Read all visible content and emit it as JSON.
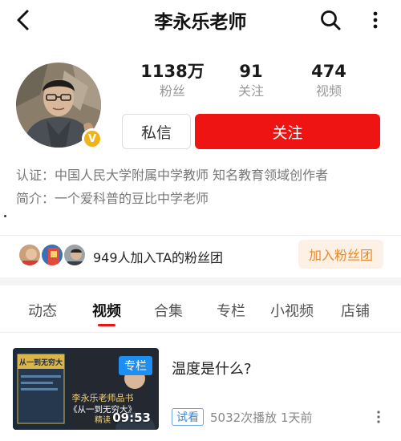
{
  "header": {
    "title": "李永乐老师"
  },
  "profile": {
    "badge_letter": "V",
    "stats": [
      {
        "value": "1138万",
        "label": "粉丝"
      },
      {
        "value": "91",
        "label": "关注"
      },
      {
        "value": "474",
        "label": "视频"
      }
    ],
    "message_label": "私信",
    "follow_label": "关注",
    "certification": "认证：中国人民大学附属中学教师 知名教育领域创作者",
    "intro": "简介：一个爱科普的豆比中学老师"
  },
  "fan_club": {
    "text": "949人加入TA的粉丝团",
    "join_label": "加入粉丝团"
  },
  "tabs": [
    "动态",
    "视频",
    "合集",
    "专栏",
    "小视频",
    "店铺"
  ],
  "active_tab": "视频",
  "video": {
    "thumb_badge": "专栏",
    "duration": "09:53",
    "thumb_book_title": "从一到无穷大",
    "thumb_line1": "李永乐老师品书",
    "thumb_line2": "《从一到无穷大》",
    "thumb_line3": "精读",
    "title": "温度是什么?",
    "trial_label": "试看",
    "meta": "5032次播放  1天前"
  },
  "colors": {
    "accent_red": "#ef1414",
    "fan_button_bg": "#fdf1e6",
    "fan_button_text": "#e38a2d",
    "badge_gold": "#f1b21c",
    "column_badge_blue": "#1f8ef1"
  }
}
